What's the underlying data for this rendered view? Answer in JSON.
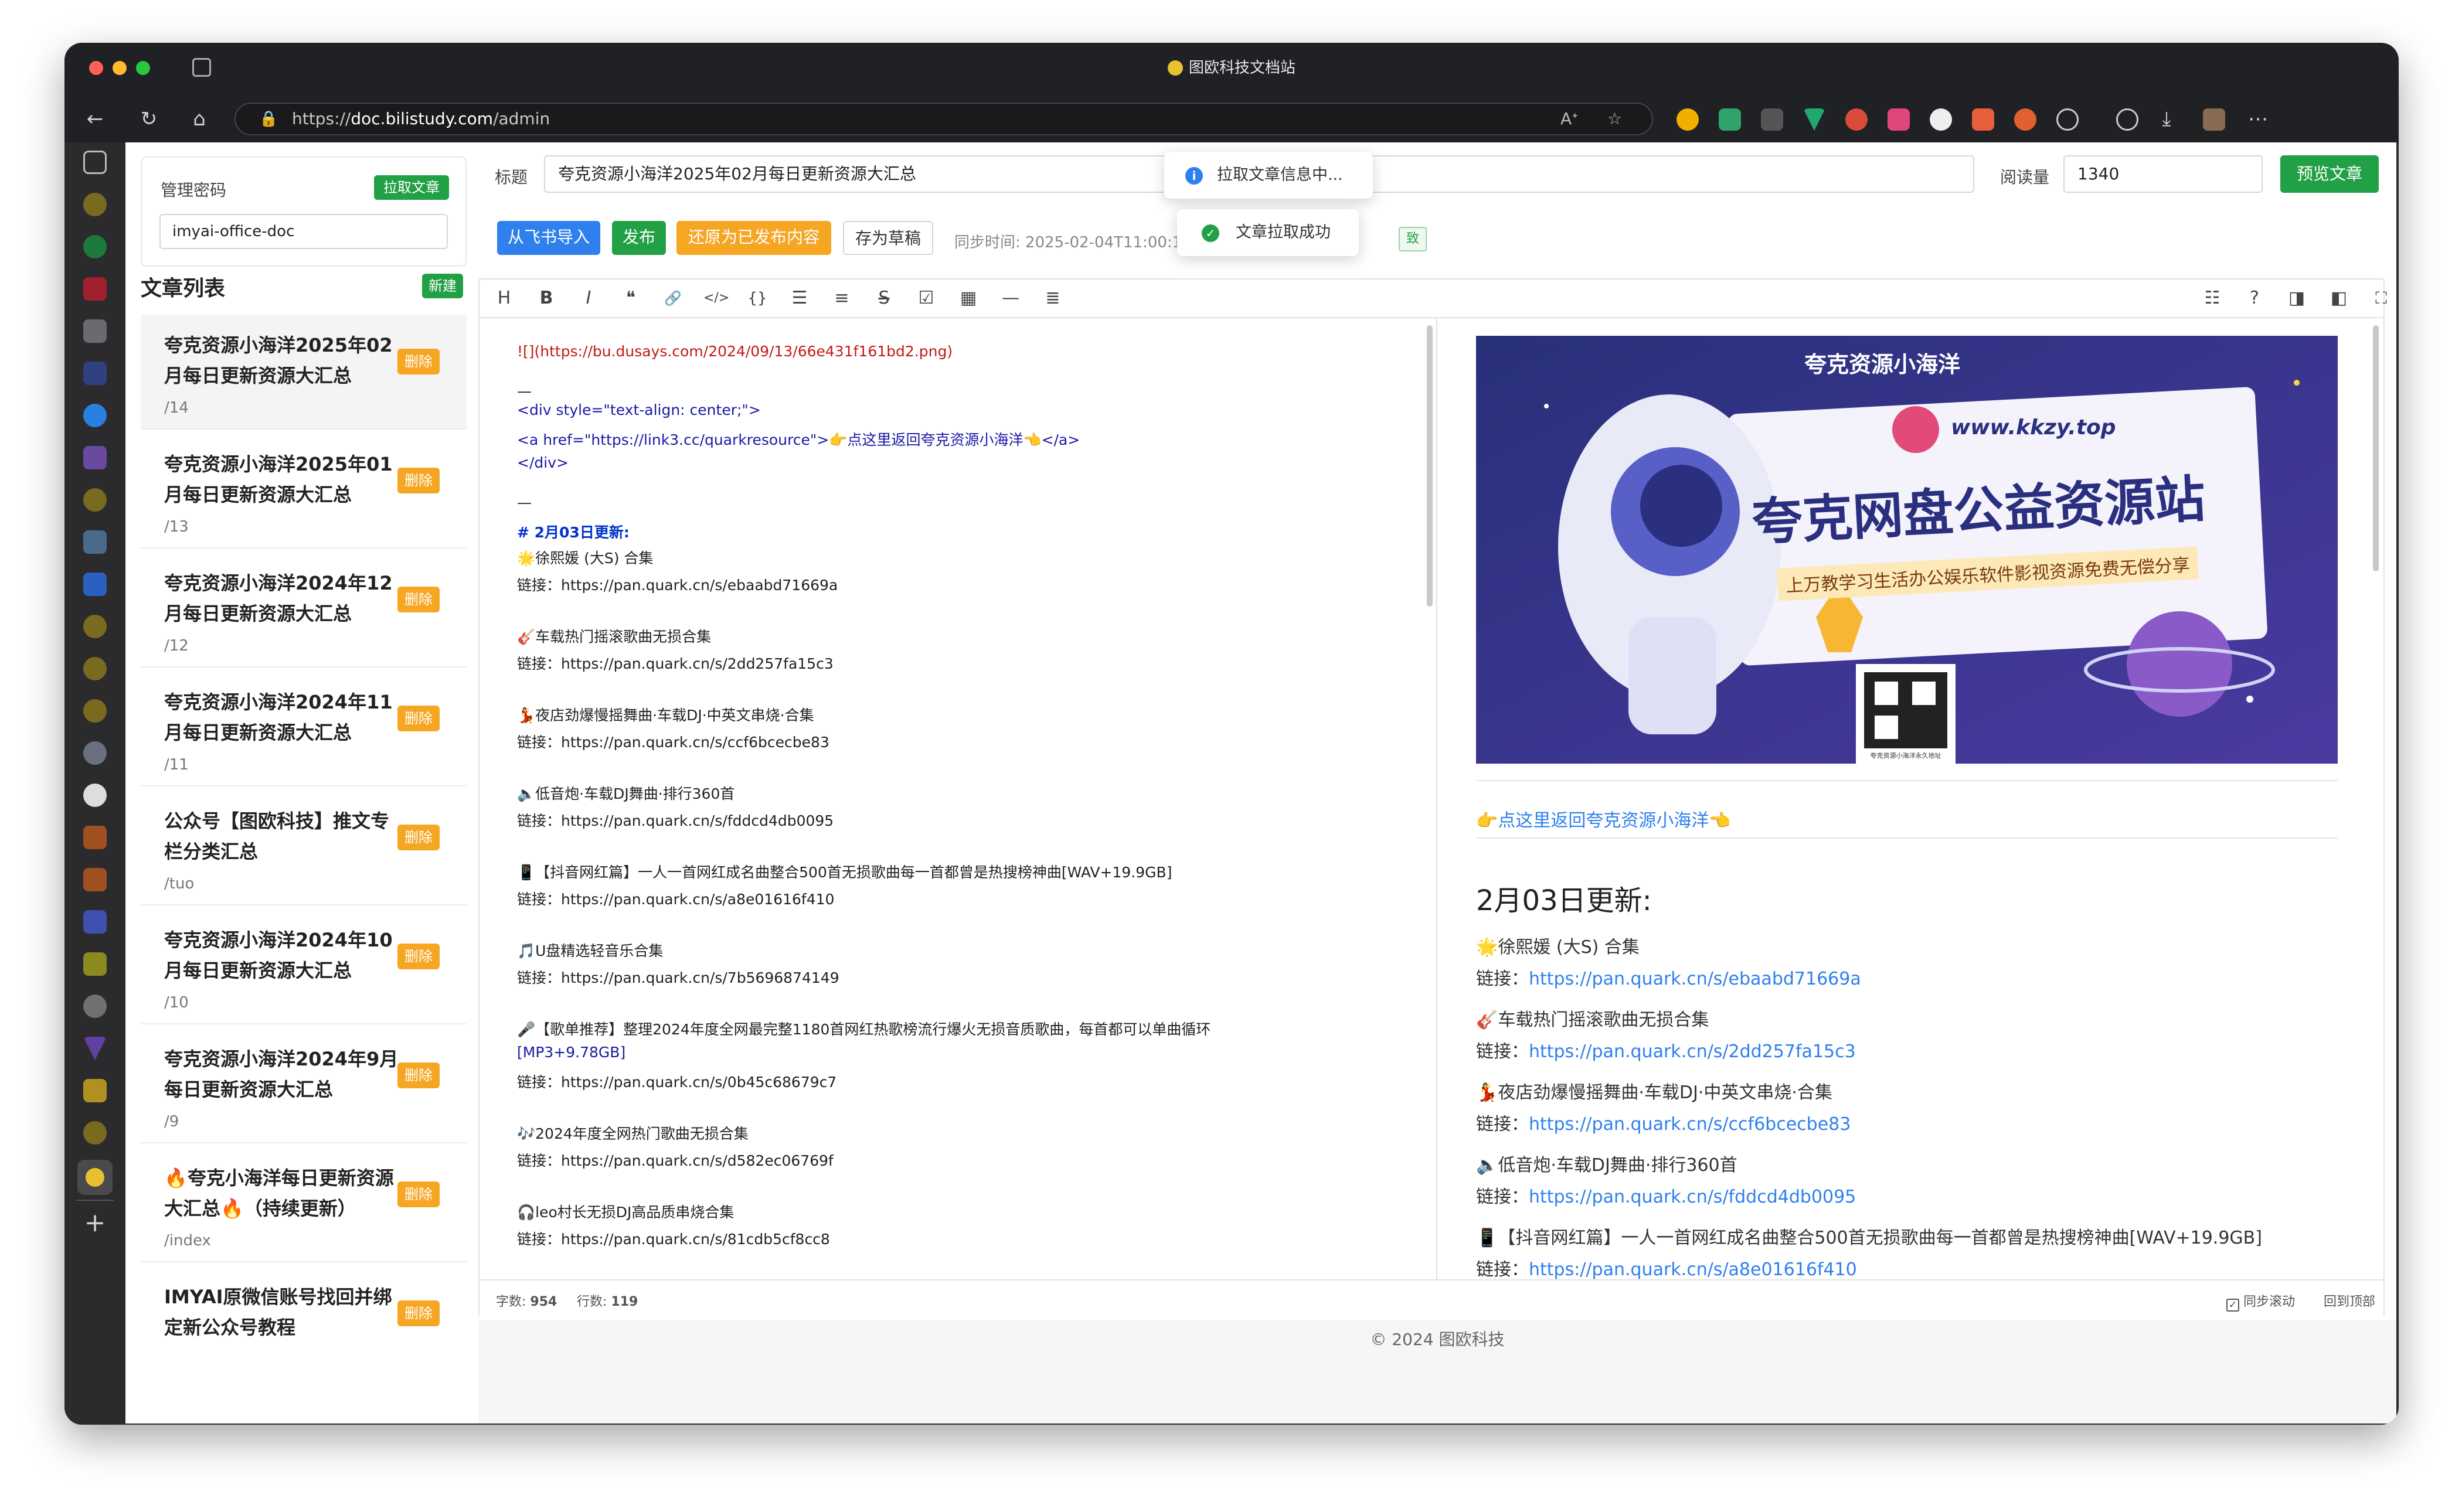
{
  "window": {
    "title": "图欧科技文档站"
  },
  "browser": {
    "url_prefix": "https://",
    "url_host": "doc.bilistudy.com",
    "url_path": "/admin"
  },
  "sidebar": {
    "password_label": "管理密码",
    "pull_button": "拉取文章",
    "password_value": "imyai-office-doc",
    "list_title": "文章列表",
    "new_button": "新建",
    "delete_label": "删除",
    "items": [
      {
        "title": "夸克资源小海洋2025年02月每日更新资源大汇总",
        "slug": "/14"
      },
      {
        "title": "夸克资源小海洋2025年01月每日更新资源大汇总",
        "slug": "/13"
      },
      {
        "title": "夸克资源小海洋2024年12月每日更新资源大汇总",
        "slug": "/12"
      },
      {
        "title": "夸克资源小海洋2024年11月每日更新资源大汇总",
        "slug": "/11"
      },
      {
        "title": "公众号【图欧科技】推文专栏分类汇总",
        "slug": "/tuo"
      },
      {
        "title": "夸克资源小海洋2024年10月每日更新资源大汇总",
        "slug": "/10"
      },
      {
        "title": "夸克资源小海洋2024年9月每日更新资源大汇总",
        "slug": "/9"
      },
      {
        "title": "🔥夸克小海洋每日更新资源大汇总🔥（持续更新）",
        "slug": "/index"
      },
      {
        "title": "IMYAI原微信账号找回并绑定新公众号教程",
        "slug": ""
      }
    ]
  },
  "header": {
    "title_label": "标题",
    "title_value": "夸克资源小海洋2025年02月每日更新资源大汇总",
    "views_label": "阅读量",
    "views_value": "1340",
    "preview_button": "预览文章"
  },
  "actions": {
    "feishu_import": "从飞书导入",
    "publish": "发布",
    "restore": "还原为已发布内容",
    "save_draft": "存为草稿",
    "sync_time": "同步时间: 2025-02-04T11:00:1",
    "sync_badge": "致"
  },
  "toasts": {
    "loading": "拉取文章信息中...",
    "success": "文章拉取成功"
  },
  "toolbar": {
    "tools": [
      "H",
      "B",
      "I",
      "❝",
      "🔗",
      "</>",
      "{}",
      "☰",
      "≡",
      "S",
      "☑",
      "▦",
      "—",
      "≣"
    ],
    "right_tools": [
      "☷",
      "?",
      "◨",
      "◧",
      "⛶",
      "⊕"
    ]
  },
  "source": {
    "lines": [
      {
        "text": "![](https://bu.dusays.com/2024/09/13/66e431f161bd2.png)",
        "cls": "red"
      },
      {
        "text": "—",
        "cls": ""
      },
      {
        "text": "<div style=\"text-align: center;\">",
        "cls": "tag"
      },
      {
        "text": "    <a href=\"https://link3.cc/quarkresource\">👉点这里返回夸克资源小海洋👈</a>",
        "cls": "tag"
      },
      {
        "text": "</div>",
        "cls": "tag"
      },
      {
        "text": "—",
        "cls": ""
      },
      {
        "text": "# 2月03日更新:",
        "cls": "h"
      },
      {
        "text": "🌟徐熙媛 (大S) 合集",
        "cls": ""
      },
      {
        "text": "链接：https://pan.quark.cn/s/ebaabd71669a",
        "cls": ""
      },
      {
        "text": "🎸车载热门摇滚歌曲无损合集",
        "cls": ""
      },
      {
        "text": "链接：https://pan.quark.cn/s/2dd257fa15c3",
        "cls": ""
      },
      {
        "text": "💃夜店劲爆慢摇舞曲·车载DJ·中英文串烧·合集",
        "cls": ""
      },
      {
        "text": "链接：https://pan.quark.cn/s/ccf6bcecbe83",
        "cls": ""
      },
      {
        "text": "🔈低音炮·车载DJ舞曲·排行360首",
        "cls": ""
      },
      {
        "text": "链接：https://pan.quark.cn/s/fddcd4db0095",
        "cls": ""
      },
      {
        "text": "📱【抖音网红篇】一人一首网红成名曲整合500首无损歌曲每一首都曾是热搜榜神曲[WAV+19.9GB]",
        "cls": ""
      },
      {
        "text": "链接：https://pan.quark.cn/s/a8e01616f410",
        "cls": ""
      },
      {
        "text": "🎵U盘精选轻音乐合集",
        "cls": ""
      },
      {
        "text": "链接：https://pan.quark.cn/s/7b5696874149",
        "cls": ""
      },
      {
        "text": "🎤【歌单推荐】整理2024年度全网最完整1180首网红热歌榜流行爆火无损音质歌曲，每首都可以单曲循环",
        "cls": ""
      },
      {
        "text": "[MP3+9.78GB]",
        "cls": "tag"
      },
      {
        "text": "链接：https://pan.quark.cn/s/0b45c68679c7",
        "cls": ""
      },
      {
        "text": "🎶2024年度全网热门歌曲无损合集",
        "cls": ""
      },
      {
        "text": "链接：https://pan.quark.cn/s/d582ec06769f",
        "cls": ""
      },
      {
        "text": "🎧leo村长无损DJ高品质串烧合集",
        "cls": ""
      },
      {
        "text": "链接：https://pan.quark.cn/s/81cdb5cf8cc8",
        "cls": ""
      }
    ]
  },
  "preview": {
    "banner_site": "夸克资源小海洋",
    "banner_url": "www.kkzy.top",
    "banner_title": "夸克网盘公益资源站",
    "banner_sub": "上万教学习生活办公娱乐软件影视资源免费无偿分享",
    "banner_qr_caption": "夸克资源小海洋永久地址",
    "back_link": "👉点这里返回夸克资源小海洋👈",
    "heading": "2月03日更新:",
    "entries": [
      {
        "name": "🌟徐熙媛 (大S) 合集",
        "link": "https://pan.quark.cn/s/ebaabd71669a"
      },
      {
        "name": "🎸车载热门摇滚歌曲无损合集",
        "link": "https://pan.quark.cn/s/2dd257fa15c3"
      },
      {
        "name": "💃夜店劲爆慢摇舞曲·车载DJ·中英文串烧·合集",
        "link": "https://pan.quark.cn/s/ccf6bcecbe83"
      },
      {
        "name": "🔈低音炮·车载DJ舞曲·排行360首",
        "link": "https://pan.quark.cn/s/fddcd4db0095"
      },
      {
        "name": "📱【抖音网红篇】一人一首网红成名曲整合500首无损歌曲每一首都曾是热搜榜神曲[WAV+19.9GB]",
        "link": "https://pan.quark.cn/s/a8e01616f410"
      }
    ],
    "link_prefix": "链接："
  },
  "status": {
    "chars_label": "字数:",
    "chars_value": "954",
    "lines_label": "行数:",
    "lines_value": "119",
    "sync_scroll": "同步滚动",
    "back_top": "回到顶部"
  },
  "footer": {
    "text": "© 2024 图欧科技"
  },
  "colors": {
    "primary_green": "#22a046",
    "blue": "#2f80ed",
    "orange": "#f5a623"
  }
}
